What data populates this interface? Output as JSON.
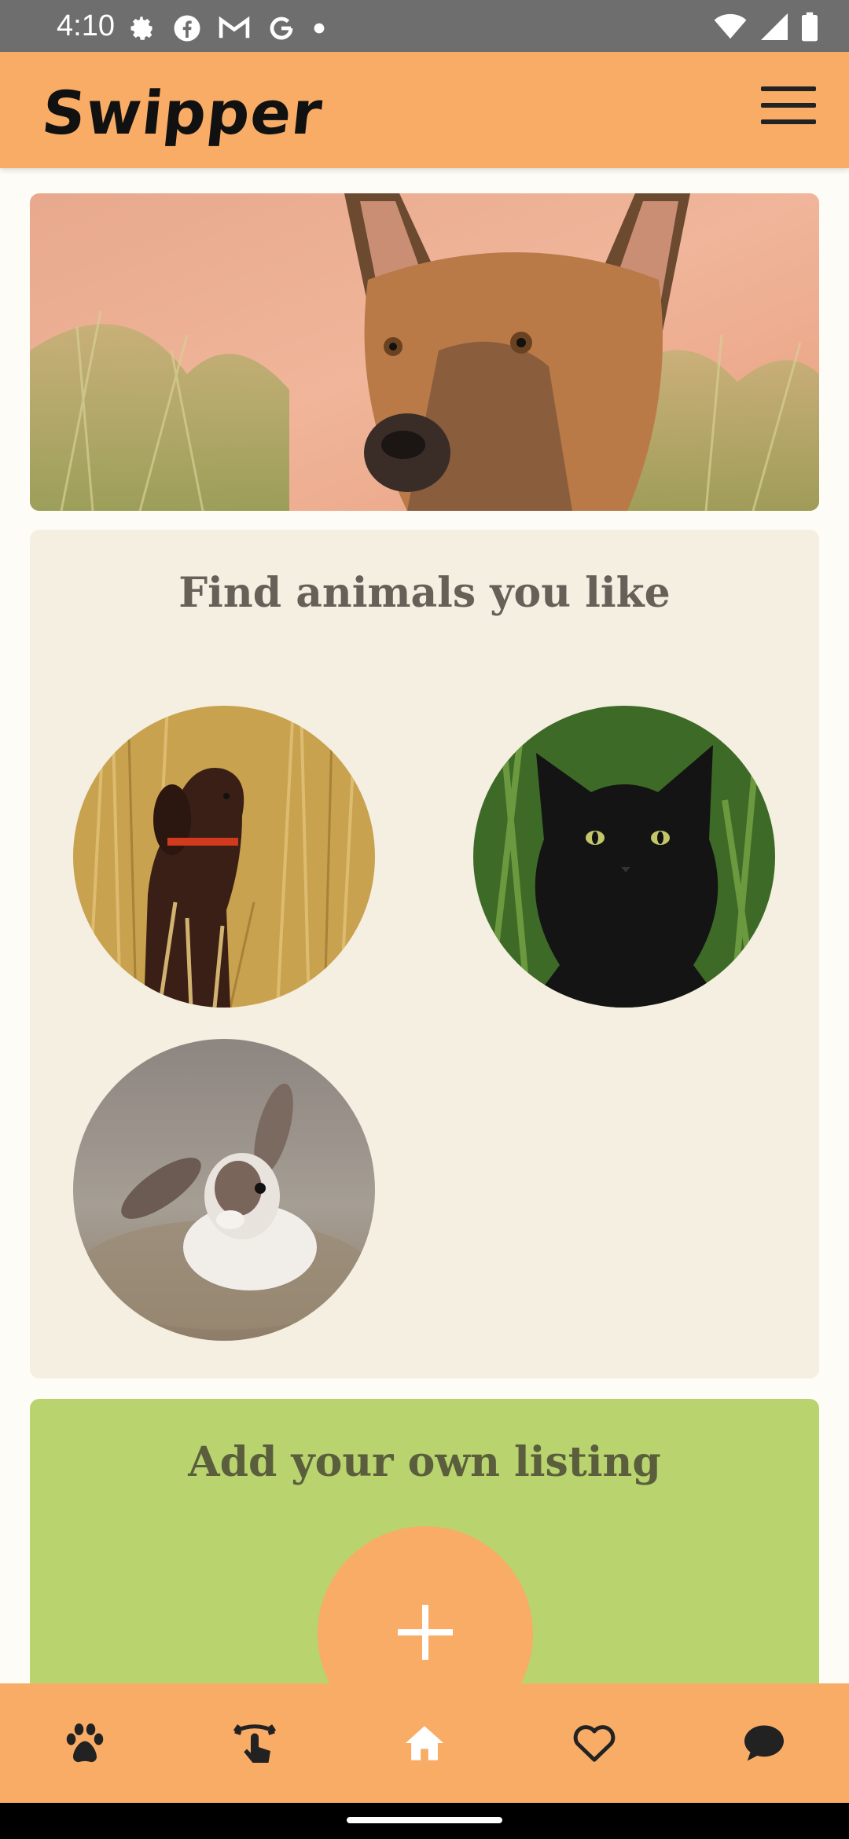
{
  "status_bar": {
    "time": "4:10",
    "left_icons": [
      "settings-icon",
      "facebook-icon",
      "gmail-icon",
      "google-icon",
      "dot-icon"
    ],
    "right_icons": [
      "wifi-icon",
      "signal-icon",
      "battery-icon"
    ]
  },
  "app_bar": {
    "title": "Swipper",
    "menu_icon": "hamburger-menu-icon",
    "color": "#f9ac66"
  },
  "hero": {
    "image": "dog-portrait"
  },
  "find_section": {
    "title": "Find animals you like",
    "animals": [
      {
        "image": "brown-spaniel-in-wheat"
      },
      {
        "image": "black-cat-in-grass"
      },
      {
        "image": "white-brown-rabbit"
      }
    ]
  },
  "add_section": {
    "title": "Add your own listing",
    "button_icon": "plus-icon",
    "color": "#b9d36e"
  },
  "bottom_nav": {
    "items": [
      "paw-icon",
      "swipe-icon",
      "home-icon",
      "heart-icon",
      "chat-icon"
    ]
  }
}
